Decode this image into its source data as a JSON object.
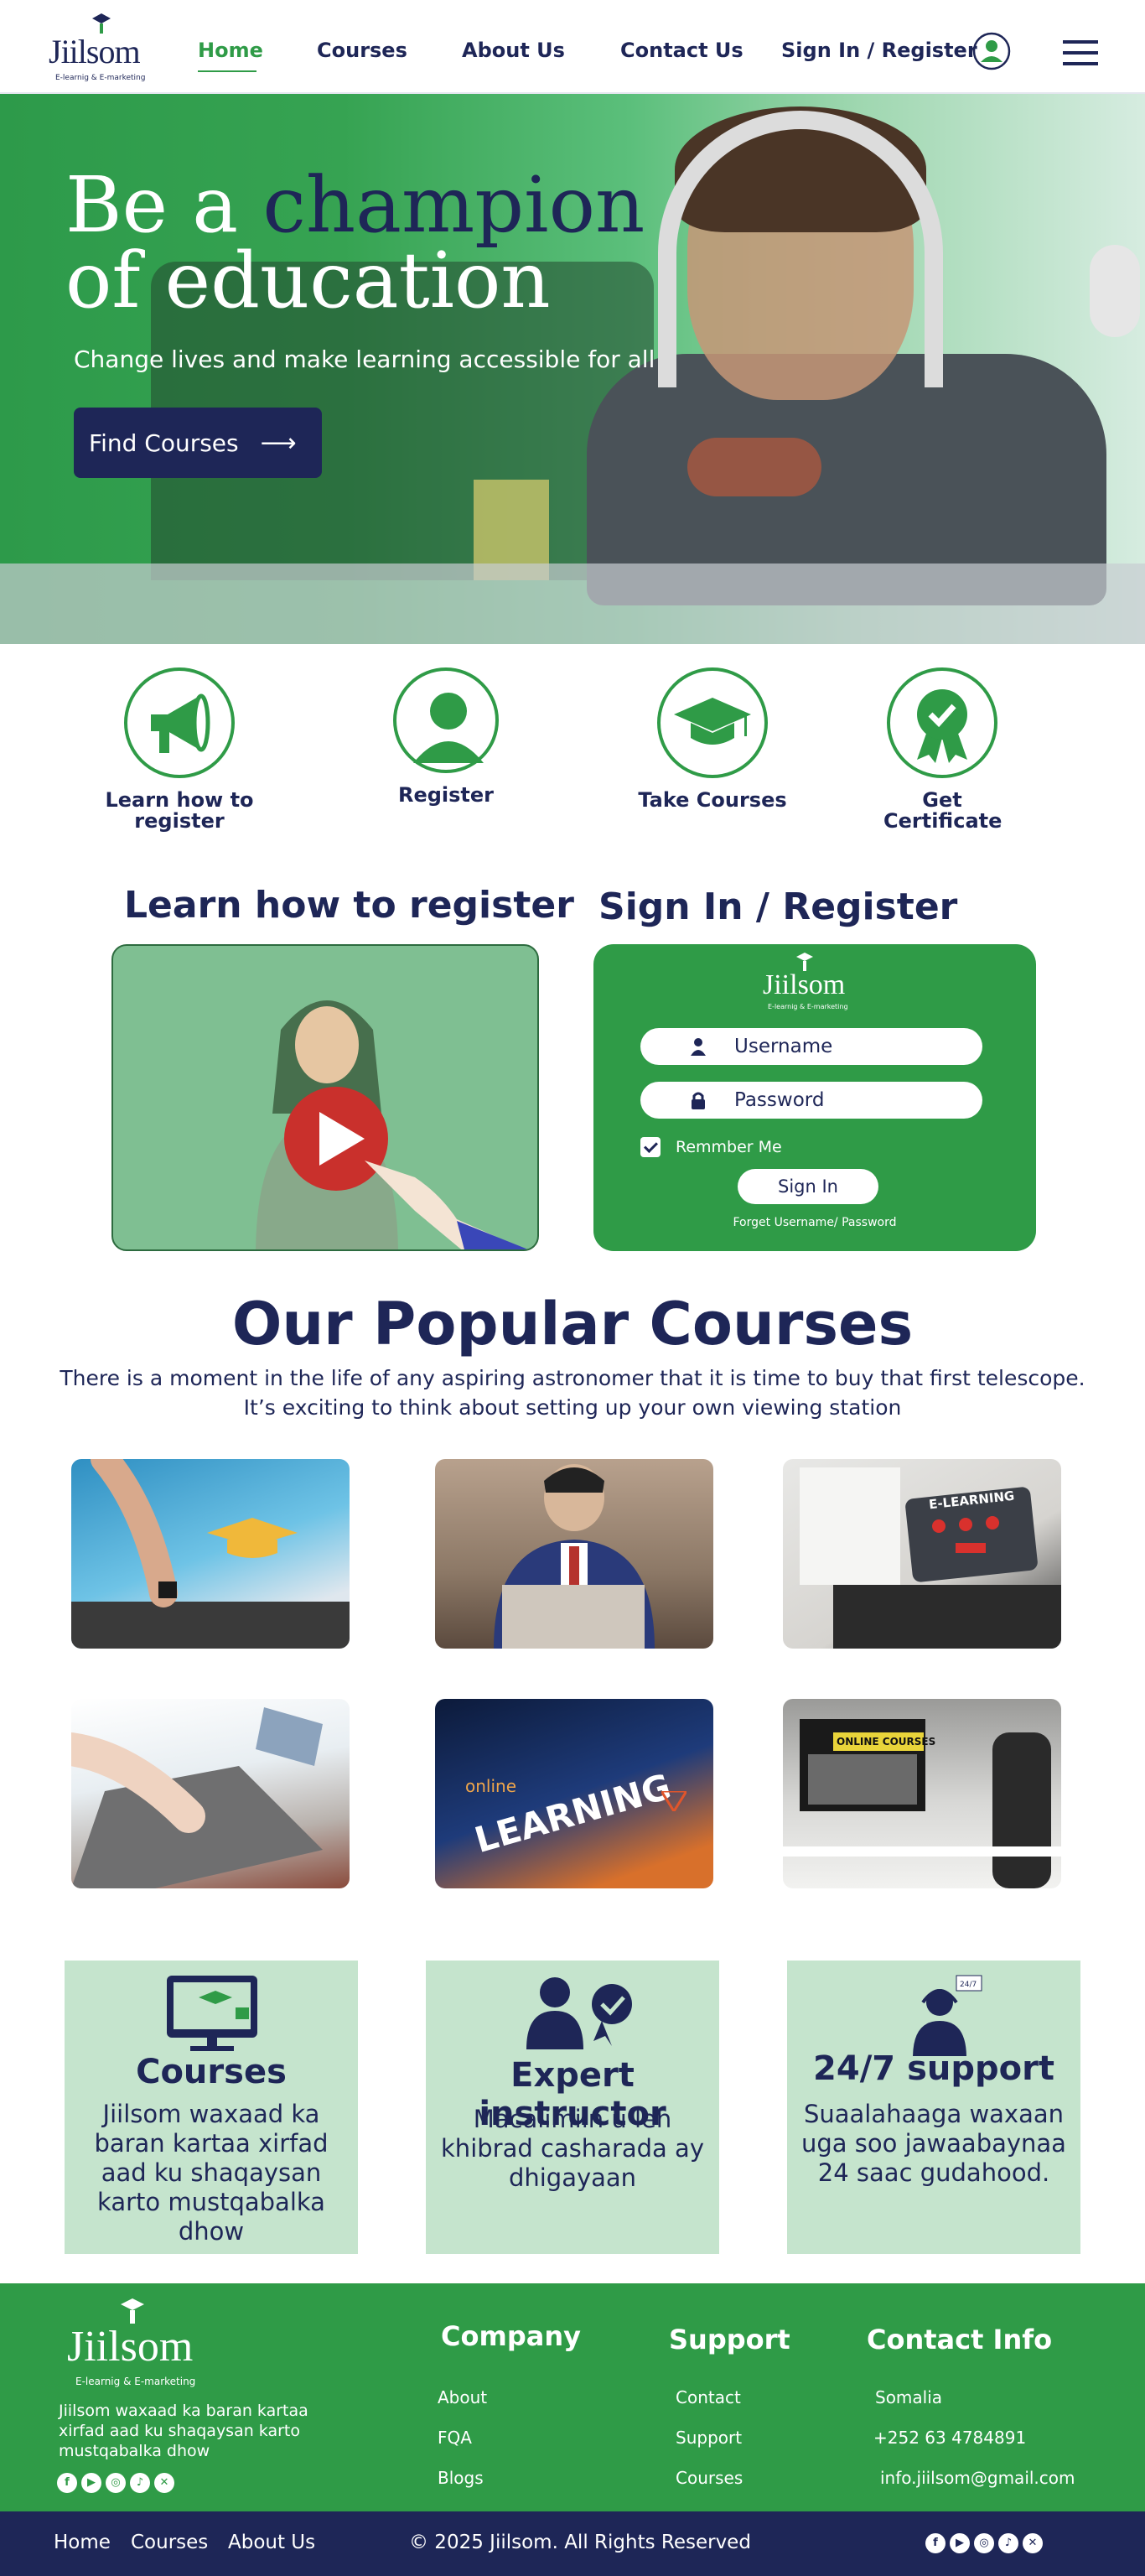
{
  "brand": {
    "name": "Jiilsom",
    "tagline": "E-learnig & E-marketing"
  },
  "nav": {
    "home": "Home",
    "courses": "Courses",
    "about": "About Us",
    "contact": "Contact Us",
    "signin": "Sign In / Register"
  },
  "hero": {
    "title_a": "Be a ",
    "title_accent": "champion",
    "title_b": "of education",
    "subtitle": "Change lives and make learning accessible for all",
    "button": "Find Courses"
  },
  "steps": [
    {
      "label": "Learn how to register",
      "icon": "megaphone-icon"
    },
    {
      "label": "Register",
      "icon": "user-icon"
    },
    {
      "label": "Take Courses",
      "icon": "graduation-cap-icon"
    },
    {
      "label": "Get Certificate",
      "icon": "certificate-icon"
    }
  ],
  "learn": {
    "title": "Learn how to register"
  },
  "signin": {
    "title": "Sign In / Register",
    "username_placeholder": "Username",
    "password_placeholder": "Password",
    "remember": "Remmber Me",
    "button": "Sign In",
    "forget": "Forget Username/ Password"
  },
  "courses": {
    "title": "Our Popular Courses",
    "description": "There is a moment in the life of any aspiring astronomer that it is time to buy that first telescope. It’s exciting to think about setting up your own viewing station",
    "labels": {
      "elearning": "E-LEARNING",
      "online_learning": "LEARNING",
      "online": "online",
      "online_courses": "ONLINE COURSES"
    }
  },
  "features": [
    {
      "title": "Courses",
      "desc": "Jiilsom waxaad ka baran kartaa xirfad aad ku shaqaysan karto mustqabalka dhow"
    },
    {
      "title": "Expert instructor",
      "desc": "Macalimiin u leh khibrad casharada ay dhigayaan"
    },
    {
      "title": "24/7  support",
      "desc": "Suaalahaaga waxaan uga soo jawaabaynaa 24 saac gudahood."
    }
  ],
  "footer": {
    "description": "Jiilsom waxaad ka baran kartaa xirfad aad ku shaqaysan karto mustqabalka dhow",
    "company": {
      "title": "Company",
      "links": [
        "About",
        "FQA",
        "Blogs"
      ]
    },
    "support": {
      "title": "Support",
      "links": [
        "Contact",
        "Support",
        "Courses"
      ]
    },
    "contact": {
      "title": "Contact Info",
      "items": [
        "Somalia",
        "+252 63 4784891",
        "info.jiilsom@gmail.com"
      ]
    }
  },
  "bottom": {
    "links": [
      "Home",
      "Courses",
      "About Us"
    ],
    "copyright": "© 2025 Jiilsom. All Rights Reserved"
  },
  "colors": {
    "primary_green": "#2f9b47",
    "navy": "#1e2657",
    "light_green": "#c5e4cd"
  }
}
